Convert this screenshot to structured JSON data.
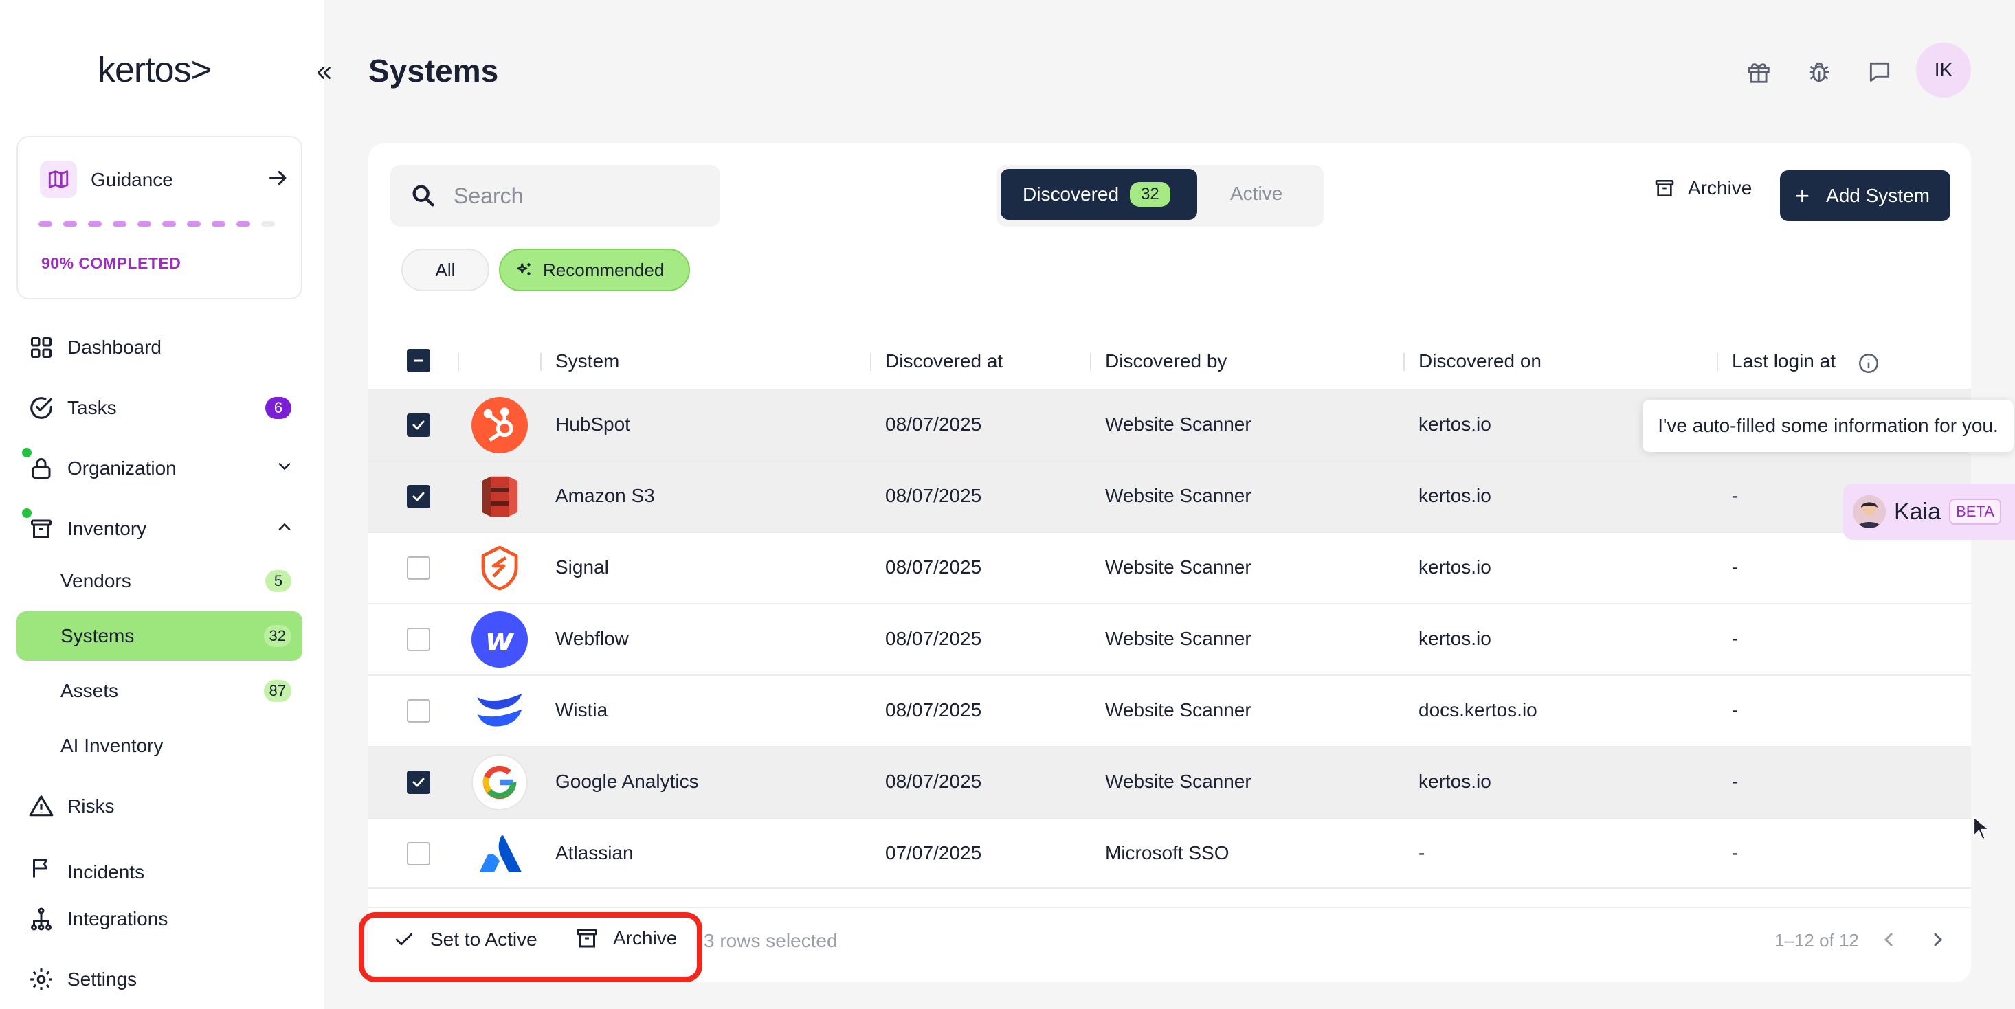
{
  "brand": {
    "logo": "kertos>"
  },
  "guidance": {
    "label": "Guidance",
    "progress_pct": 90,
    "completed_text": "90% COMPLETED"
  },
  "nav": {
    "dashboard": "Dashboard",
    "tasks": "Tasks",
    "tasks_badge": "6",
    "organization": "Organization",
    "inventory": "Inventory",
    "vendors": "Vendors",
    "vendors_badge": "5",
    "systems": "Systems",
    "systems_badge": "32",
    "assets": "Assets",
    "assets_badge": "87",
    "ai_inventory": "AI Inventory",
    "risks": "Risks",
    "incidents": "Incidents",
    "integrations": "Integrations",
    "settings": "Settings"
  },
  "header": {
    "title": "Systems",
    "avatar_initials": "IK"
  },
  "toolbar": {
    "search_placeholder": "Search",
    "tab_discovered": "Discovered",
    "tab_discovered_count": "32",
    "tab_active": "Active",
    "archive": "Archive",
    "add_system": "Add System",
    "filter_all": "All",
    "filter_recommended": "Recommended"
  },
  "table": {
    "columns": [
      "System",
      "Discovered at",
      "Discovered by",
      "Discovered on",
      "Last login at"
    ],
    "rows": [
      {
        "system": "HubSpot",
        "discovered_at": "08/07/2025",
        "discovered_by": "Website Scanner",
        "discovered_on": "kertos.io",
        "last_login": "",
        "selected": true,
        "logo": "hubspot"
      },
      {
        "system": "Amazon S3",
        "discovered_at": "08/07/2025",
        "discovered_by": "Website Scanner",
        "discovered_on": "kertos.io",
        "last_login": "-",
        "selected": true,
        "logo": "s3"
      },
      {
        "system": "Signal",
        "discovered_at": "08/07/2025",
        "discovered_by": "Website Scanner",
        "discovered_on": "kertos.io",
        "last_login": "-",
        "selected": false,
        "logo": "signal"
      },
      {
        "system": "Webflow",
        "discovered_at": "08/07/2025",
        "discovered_by": "Website Scanner",
        "discovered_on": "kertos.io",
        "last_login": "-",
        "selected": false,
        "logo": "webflow"
      },
      {
        "system": "Wistia",
        "discovered_at": "08/07/2025",
        "discovered_by": "Website Scanner",
        "discovered_on": "docs.kertos.io",
        "last_login": "-",
        "selected": false,
        "logo": "wistia"
      },
      {
        "system": "Google Analytics",
        "discovered_at": "08/07/2025",
        "discovered_by": "Website Scanner",
        "discovered_on": "kertos.io",
        "last_login": "-",
        "selected": true,
        "logo": "google"
      },
      {
        "system": "Atlassian",
        "discovered_at": "07/07/2025",
        "discovered_by": "Microsoft SSO",
        "discovered_on": "-",
        "last_login": "-",
        "selected": false,
        "logo": "atlassian"
      }
    ]
  },
  "footer": {
    "set_active": "Set to Active",
    "archive": "Archive",
    "rows_selected": "3 rows selected",
    "pagination": "1–12 of 12"
  },
  "assistant": {
    "tooltip": "I've auto-filled some information for you.",
    "name": "Kaia",
    "badge": "BETA"
  },
  "colors": {
    "primary_dark": "#1b2a45",
    "accent_green": "#9de67d",
    "purple": "#7b1fd6",
    "highlight_red": "#f0281d"
  }
}
